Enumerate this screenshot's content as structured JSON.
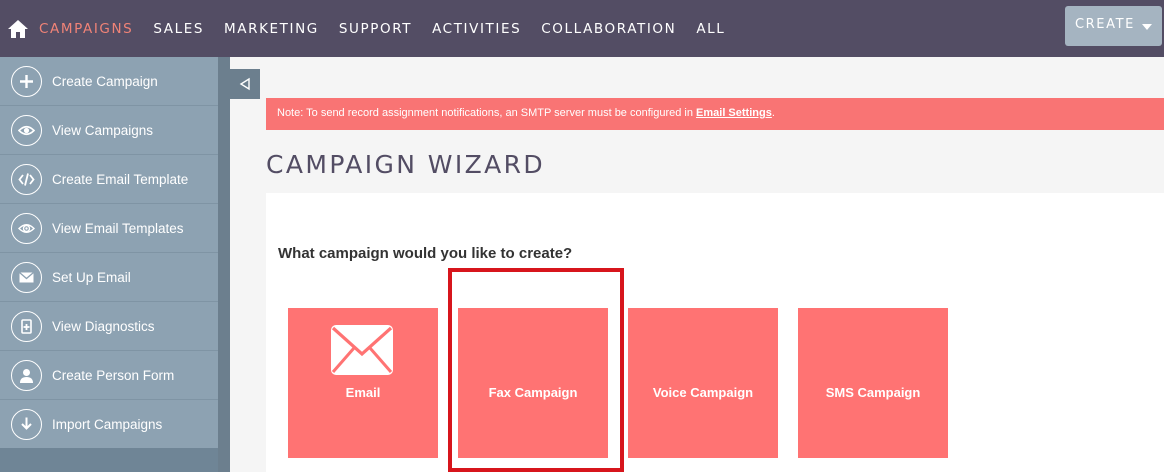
{
  "nav": {
    "items": [
      {
        "label": "CAMPAIGNS",
        "active": true
      },
      {
        "label": "SALES"
      },
      {
        "label": "MARKETING"
      },
      {
        "label": "SUPPORT"
      },
      {
        "label": "ACTIVITIES"
      },
      {
        "label": "COLLABORATION"
      },
      {
        "label": "ALL"
      }
    ],
    "create_label": "CREATE"
  },
  "sidebar": {
    "items": [
      {
        "label": "Create Campaign",
        "icon": "plus-icon"
      },
      {
        "label": "View Campaigns",
        "icon": "eye-icon"
      },
      {
        "label": "Create Email Template",
        "icon": "code-icon"
      },
      {
        "label": "View Email Templates",
        "icon": "eye-at-icon"
      },
      {
        "label": "Set Up Email",
        "icon": "envelope-icon"
      },
      {
        "label": "View Diagnostics",
        "icon": "diagnostics-icon"
      },
      {
        "label": "Create Person Form",
        "icon": "person-icon"
      },
      {
        "label": "Import Campaigns",
        "icon": "import-icon"
      }
    ]
  },
  "notice": {
    "text": "Note: To send record assignment notifications, an SMTP server must be configured in ",
    "link": "Email Settings",
    "suffix": "."
  },
  "page": {
    "title": "CAMPAIGN WIZARD",
    "question": "What campaign would you like to create?"
  },
  "campaign_types": [
    {
      "label": "Email",
      "icon": "envelope-icon"
    },
    {
      "label": "Fax Campaign"
    },
    {
      "label": "Voice Campaign"
    },
    {
      "label": "SMS Campaign"
    }
  ],
  "colors": {
    "nav_bg": "#534d64",
    "nav_active": "#f08377",
    "sidebar_bg": "#8da2b2",
    "tile_bg": "#ff7373",
    "notice_bg": "#f97474",
    "highlight": "#d7151c"
  }
}
